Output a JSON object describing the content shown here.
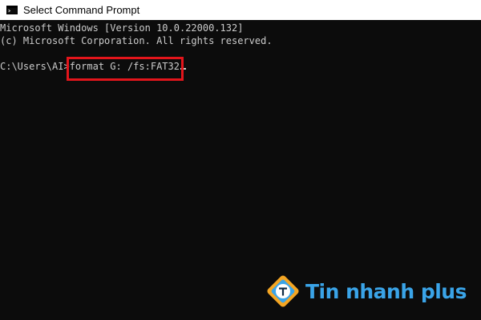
{
  "window": {
    "title": "Select Command Prompt",
    "icon": "cmd-icon"
  },
  "console": {
    "line1": "Microsoft Windows [Version 10.0.22000.132]",
    "line2": "(c) Microsoft Corporation. All rights reserved.",
    "prompt": "C:\\Users\\AI>",
    "command": "format G: /fs:FAT32"
  },
  "highlight": {
    "color": "#e3151b"
  },
  "watermark": {
    "text": "Tin nhanh plus",
    "logo": "tin-nhanh-plus-logo",
    "color": "#3aa4e8"
  }
}
